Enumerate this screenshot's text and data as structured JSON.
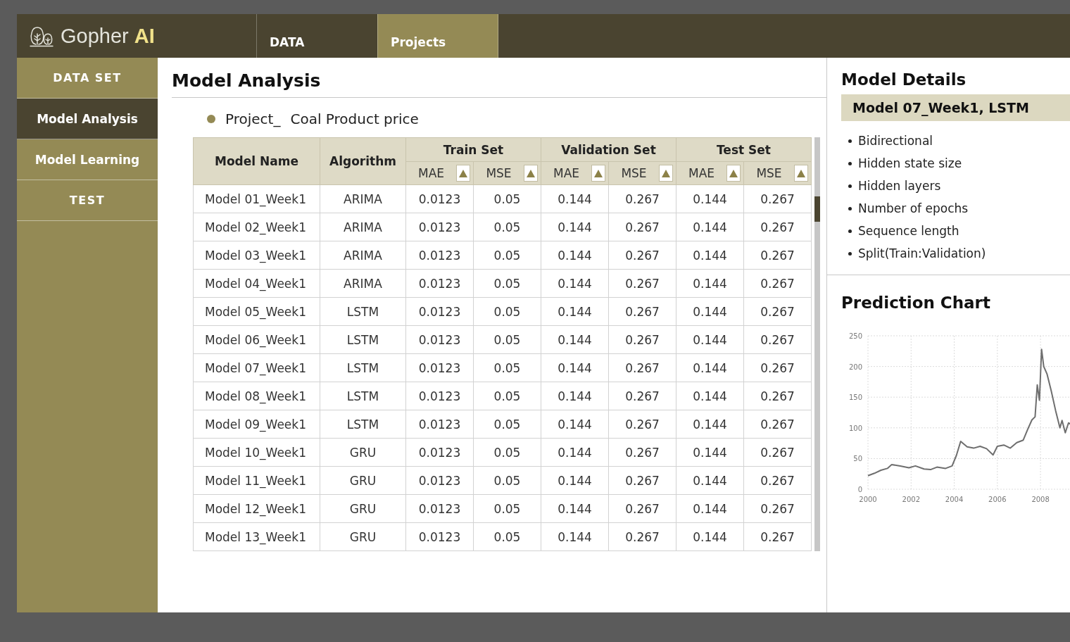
{
  "header": {
    "logo": {
      "name": "Gopher",
      "accent": "AI"
    },
    "tabs": [
      {
        "label": "DATA",
        "selected": false
      },
      {
        "label": "Projects",
        "selected": true
      }
    ]
  },
  "sidebar": {
    "items": [
      {
        "label": "DATA SET",
        "selected": false
      },
      {
        "label": "Model Analysis",
        "selected": true
      },
      {
        "label": "Model Learning",
        "selected": false
      },
      {
        "label": "TEST",
        "selected": false
      }
    ]
  },
  "main": {
    "title": "Model Analysis",
    "project": {
      "label": "Project_",
      "value": "Coal Product price"
    },
    "table": {
      "header_rows": [
        [
          {
            "label": "Model Name",
            "rowspan": 2
          },
          {
            "label": "Algorithm",
            "rowspan": 2
          },
          {
            "label": "Train Set",
            "colspan": 2
          },
          {
            "label": "Validation Set",
            "colspan": 2
          },
          {
            "label": "Test Set",
            "colspan": 2
          }
        ],
        [
          {
            "label": "MAE",
            "sortable": true
          },
          {
            "label": "MSE",
            "sortable": true
          },
          {
            "label": "MAE",
            "sortable": true
          },
          {
            "label": "MSE",
            "sortable": true
          },
          {
            "label": "MAE",
            "sortable": true
          },
          {
            "label": "MSE",
            "sortable": true
          }
        ]
      ],
      "rows": [
        [
          "Model 01_Week1",
          "ARIMA",
          "0.0123",
          "0.05",
          "0.144",
          "0.267",
          "0.144",
          "0.267"
        ],
        [
          "Model 02_Week1",
          "ARIMA",
          "0.0123",
          "0.05",
          "0.144",
          "0.267",
          "0.144",
          "0.267"
        ],
        [
          "Model 03_Week1",
          "ARIMA",
          "0.0123",
          "0.05",
          "0.144",
          "0.267",
          "0.144",
          "0.267"
        ],
        [
          "Model 04_Week1",
          "ARIMA",
          "0.0123",
          "0.05",
          "0.144",
          "0.267",
          "0.144",
          "0.267"
        ],
        [
          "Model 05_Week1",
          "LSTM",
          "0.0123",
          "0.05",
          "0.144",
          "0.267",
          "0.144",
          "0.267"
        ],
        [
          "Model 06_Week1",
          "LSTM",
          "0.0123",
          "0.05",
          "0.144",
          "0.267",
          "0.144",
          "0.267"
        ],
        [
          "Model 07_Week1",
          "LSTM",
          "0.0123",
          "0.05",
          "0.144",
          "0.267",
          "0.144",
          "0.267"
        ],
        [
          "Model 08_Week1",
          "LSTM",
          "0.0123",
          "0.05",
          "0.144",
          "0.267",
          "0.144",
          "0.267"
        ],
        [
          "Model 09_Week1",
          "LSTM",
          "0.0123",
          "0.05",
          "0.144",
          "0.267",
          "0.144",
          "0.267"
        ],
        [
          "Model 10_Week1",
          "GRU",
          "0.0123",
          "0.05",
          "0.144",
          "0.267",
          "0.144",
          "0.267"
        ],
        [
          "Model 11_Week1",
          "GRU",
          "0.0123",
          "0.05",
          "0.144",
          "0.267",
          "0.144",
          "0.267"
        ],
        [
          "Model 12_Week1",
          "GRU",
          "0.0123",
          "0.05",
          "0.144",
          "0.267",
          "0.144",
          "0.267"
        ],
        [
          "Model 13_Week1",
          "GRU",
          "0.0123",
          "0.05",
          "0.144",
          "0.267",
          "0.144",
          "0.267"
        ]
      ]
    }
  },
  "details": {
    "title": "Model Details",
    "model": "Model 07_Week1, LSTM",
    "items": [
      "Bidirectional",
      "Hidden state size",
      "Hidden layers",
      "Number of epochs",
      "Sequence length",
      "Split(Train:Validation)"
    ]
  },
  "chart": {
    "title": "Prediction Chart",
    "chart_data": {
      "type": "line",
      "grid": true,
      "x": [
        2000,
        2000.3,
        2000.6,
        2000.9,
        2001.1,
        2001.5,
        2001.9,
        2002.2,
        2002.6,
        2002.9,
        2003.2,
        2003.6,
        2003.9,
        2004.1,
        2004.3,
        2004.6,
        2004.9,
        2005.2,
        2005.5,
        2005.8,
        2006,
        2006.3,
        2006.6,
        2006.9,
        2007.2,
        2007.4,
        2007.6,
        2007.75,
        2007.85,
        2007.95,
        2008.05,
        2008.15,
        2008.3,
        2008.5,
        2008.7,
        2008.9,
        2009,
        2009.15,
        2009.3,
        2009.4
      ],
      "series": [
        {
          "color": "#6e6e6e",
          "values": [
            22,
            26,
            31,
            34,
            40,
            38,
            35,
            38,
            33,
            32,
            36,
            34,
            38,
            55,
            78,
            69,
            67,
            70,
            66,
            56,
            70,
            72,
            67,
            76,
            80,
            97,
            113,
            118,
            170,
            145,
            228,
            200,
            188,
            160,
            128,
            100,
            112,
            92,
            108,
            106
          ]
        }
      ],
      "xlim": [
        2000,
        2009.4
      ],
      "ylim": [
        0,
        250
      ],
      "xticks": [
        2000,
        2002,
        2004,
        2006,
        2008
      ],
      "yticks": [
        0,
        50,
        100,
        150,
        200,
        250
      ]
    }
  }
}
